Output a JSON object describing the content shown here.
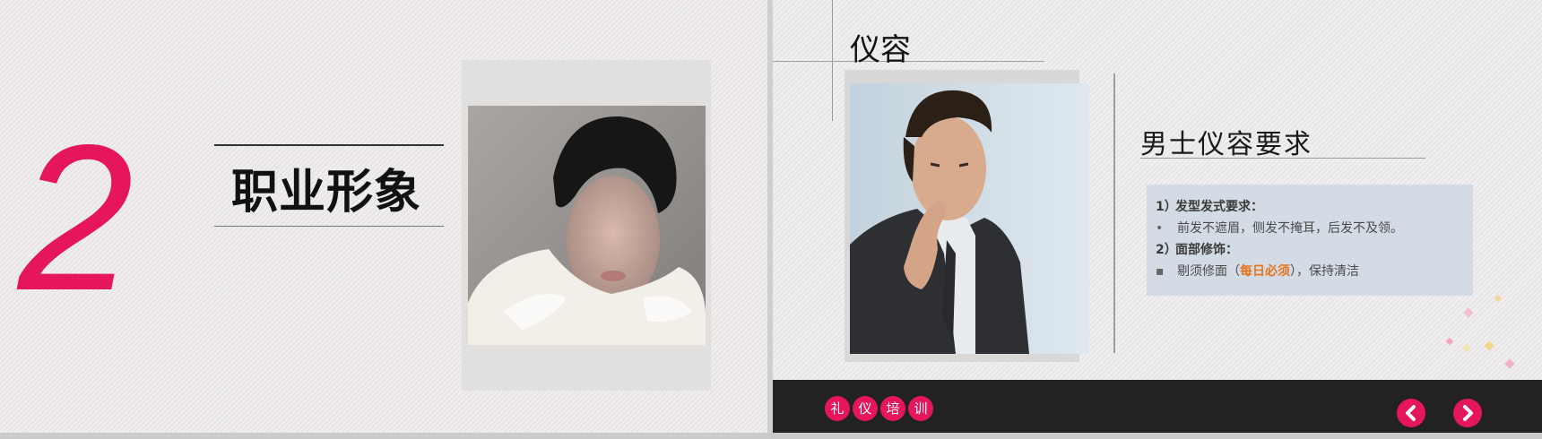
{
  "left_slide": {
    "number": "2",
    "title": "职业形象"
  },
  "right_slide": {
    "title": "仪容",
    "subtitle": "男士仪容要求",
    "requirements": [
      {
        "num": "1）",
        "heading": "发型发式要求："
      },
      {
        "bullet": "•",
        "text": "前发不遮眉，侧发不掩耳，后发不及领。"
      },
      {
        "num": "2）",
        "heading": "面部修饰："
      },
      {
        "bullet": "▪",
        "prefix": "剔须修面（",
        "highlight": "每日必须",
        "suffix": "），保持清洁"
      }
    ],
    "footer_chars": [
      "礼",
      "仪",
      "培",
      "训"
    ],
    "nav": {
      "prev_icon": "chevron-left-icon",
      "next_icon": "chevron-right-icon"
    }
  },
  "colors": {
    "accent": "#e5165a",
    "highlight": "#e8731c",
    "footer_bg": "#222222",
    "info_box_bg": "#d3dbe5"
  }
}
